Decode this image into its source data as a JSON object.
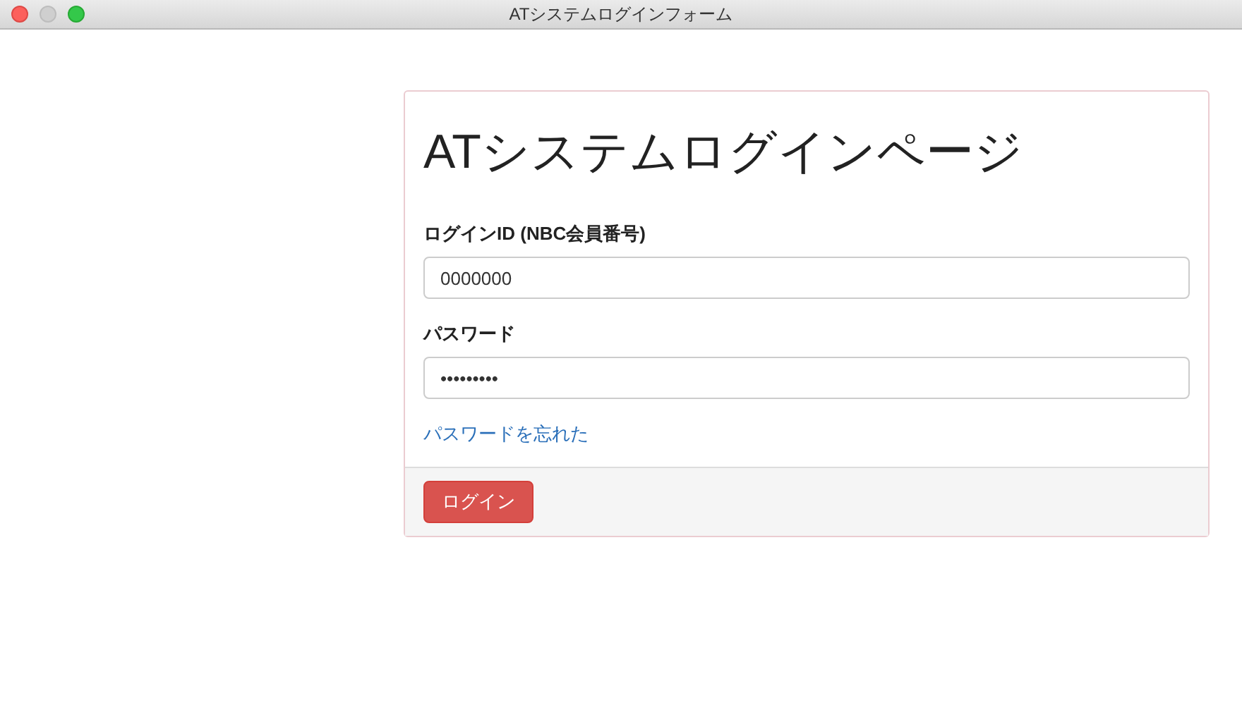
{
  "window": {
    "title": "ATシステムログインフォーム"
  },
  "panel": {
    "heading": "ATシステムログインページ",
    "fields": [
      {
        "label": "ログインID (NBC会員番号)",
        "value": "0000000"
      },
      {
        "label": "パスワード",
        "value": "•••••••••"
      }
    ],
    "link": "パスワードを忘れた",
    "button": "ログイン"
  }
}
